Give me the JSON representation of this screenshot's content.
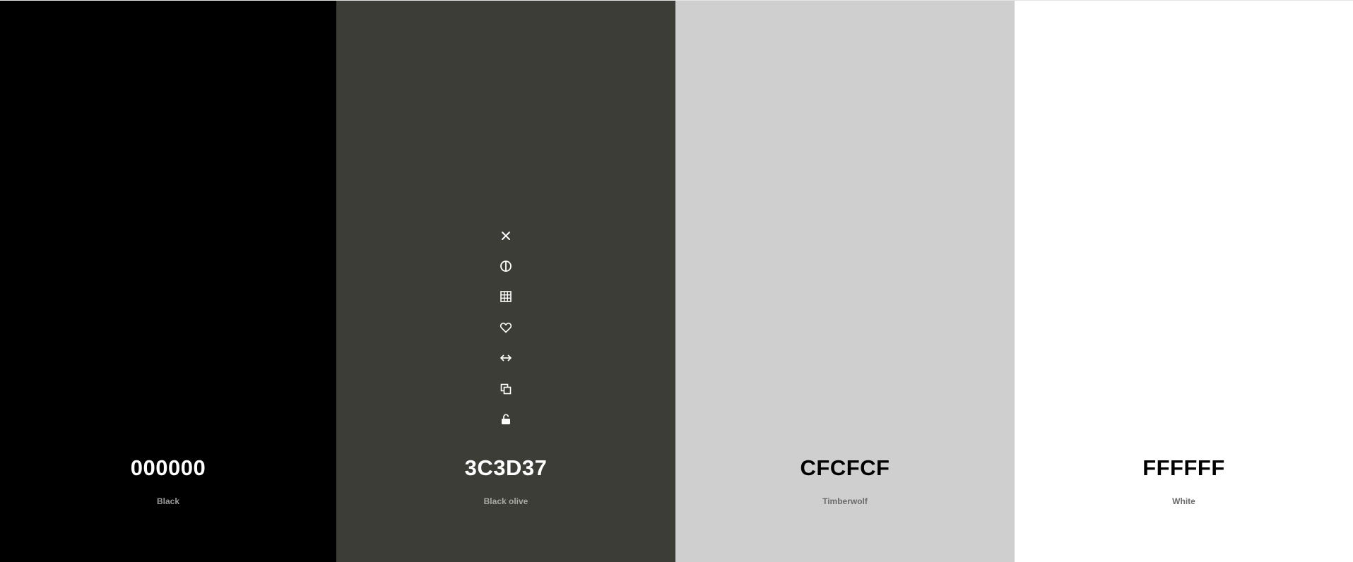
{
  "swatches": [
    {
      "hex": "000000",
      "name": "Black",
      "bg": "#000000",
      "hex_color": "#ffffff",
      "name_color": "#9a9a9a"
    },
    {
      "hex": "3C3D37",
      "name": "Black olive",
      "bg": "#3C3D37",
      "hex_color": "#ffffff",
      "name_color": "#a9aaa4"
    },
    {
      "hex": "CFCFCF",
      "name": "Timberwolf",
      "bg": "#CFCFCF",
      "hex_color": "#000000",
      "name_color": "#6b6b6b"
    },
    {
      "hex": "FFFFFF",
      "name": "White",
      "bg": "#FFFFFF",
      "hex_color": "#000000",
      "name_color": "#6b6b6b"
    }
  ],
  "toolbar": {
    "icons": [
      "close-icon",
      "contrast-icon",
      "shades-grid-icon",
      "heart-icon",
      "drag-arrows-icon",
      "copy-icon",
      "unlock-icon"
    ],
    "color": "#ffffff"
  }
}
